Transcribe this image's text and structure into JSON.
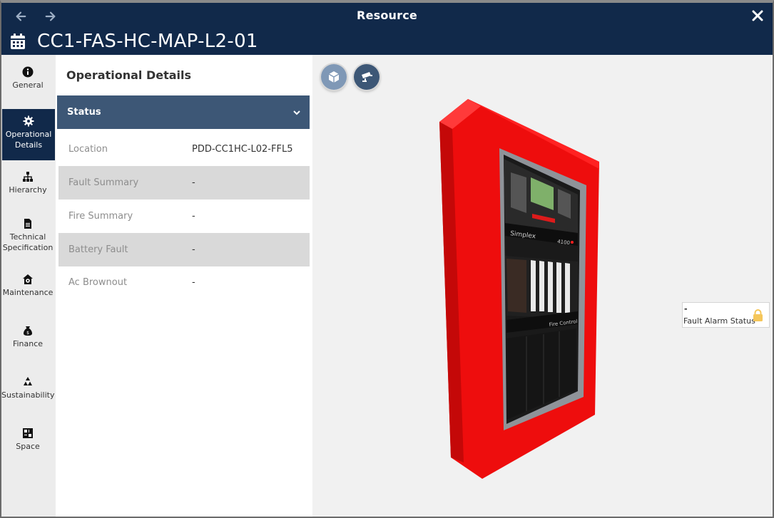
{
  "window": {
    "title": "Resource",
    "back_icon": "arrow-left-icon",
    "forward_icon": "arrow-right-icon",
    "close_icon": "close-icon"
  },
  "resource": {
    "icon": "calendar-icon",
    "name": "CC1-FAS-HC-MAP-L2-01"
  },
  "sidebar": {
    "items": [
      {
        "label": "General",
        "icon": "info-icon",
        "active": false
      },
      {
        "label": "Operational Details",
        "icon": "gear-icon",
        "active": true
      },
      {
        "label": "Hierarchy",
        "icon": "hierarchy-icon",
        "active": false
      },
      {
        "label": "Technical Specification",
        "icon": "document-icon",
        "active": false
      },
      {
        "label": "Maintenance",
        "icon": "home-gear-icon",
        "active": false
      },
      {
        "label": "Finance",
        "icon": "money-bag-icon",
        "active": false
      },
      {
        "label": "Sustainability",
        "icon": "recycle-icon",
        "active": false
      },
      {
        "label": "Space",
        "icon": "floorplan-icon",
        "active": false
      }
    ]
  },
  "details": {
    "title": "Operational Details",
    "section": {
      "label": "Status",
      "expanded": true,
      "chevron_icon": "chevron-down-icon"
    },
    "rows": [
      {
        "label": "Location",
        "value": "PDD-CC1HC-L02-FFL5"
      },
      {
        "label": "Fault Summary",
        "value": "-"
      },
      {
        "label": "Fire Summary",
        "value": "-"
      },
      {
        "label": "Battery Fault",
        "value": "-"
      },
      {
        "label": "Ac Brownout",
        "value": "-"
      }
    ]
  },
  "viewer": {
    "tools": [
      {
        "name": "cube-view",
        "icon": "cube-icon"
      },
      {
        "name": "camera-view",
        "icon": "cctv-camera-icon"
      }
    ],
    "panel": {
      "brand": "Simplex",
      "model": "4100",
      "sublabel": "Fire Control"
    },
    "status_card": {
      "value": "-",
      "label": "Fault Alarm Status",
      "icon": "lock-icon"
    }
  },
  "colors": {
    "header_bg": "#11294a",
    "section_bg": "#3d5776",
    "panel_red": "#ff1010",
    "lock_color": "#f5c65a"
  }
}
